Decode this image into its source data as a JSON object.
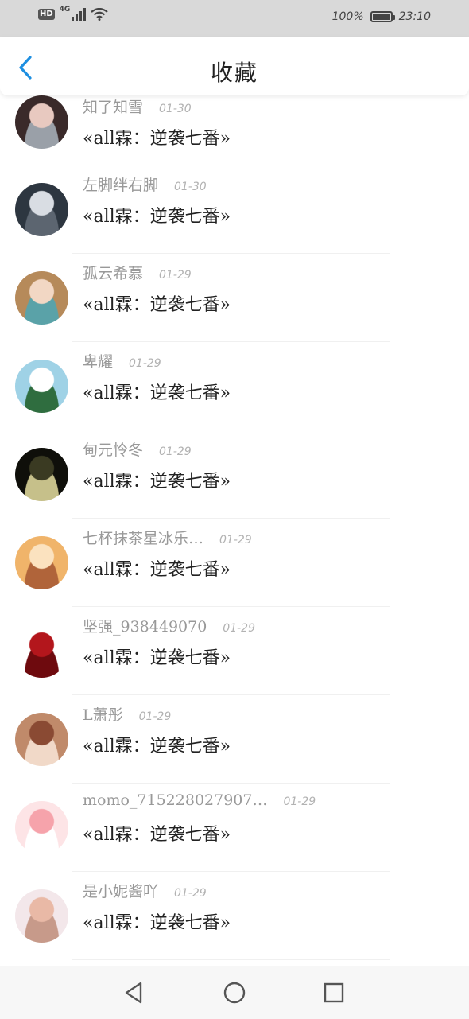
{
  "status_bar": {
    "hd_label": "HD",
    "network_label": "4G",
    "battery_percent": "100%",
    "time": "23:10"
  },
  "header": {
    "title": "收藏"
  },
  "favorites": [
    {
      "username": "知了知雪",
      "date": "01-30",
      "message": "«all霖：逆袭七番»",
      "avatar_colors": [
        "#3a2a2a",
        "#e8c9c0",
        "#9aa0a8"
      ]
    },
    {
      "username": "左脚绊右脚",
      "date": "01-30",
      "message": "«all霖：逆袭七番»",
      "avatar_colors": [
        "#2d3640",
        "#d9dde3",
        "#5c6570"
      ]
    },
    {
      "username": "孤云希慕",
      "date": "01-29",
      "message": "«all霖：逆袭七番»",
      "avatar_colors": [
        "#b68a5a",
        "#f2d7c4",
        "#5aa2a8"
      ]
    },
    {
      "username": "卑耀",
      "date": "01-29",
      "message": "«all霖：逆袭七番»",
      "avatar_colors": [
        "#9fd2e6",
        "#ffffff",
        "#2f6d3f"
      ]
    },
    {
      "username": "甸元怜冬",
      "date": "01-29",
      "message": "«all霖：逆袭七番»",
      "avatar_colors": [
        "#0f0f0a",
        "#3a3a22",
        "#c6c08a"
      ]
    },
    {
      "username": "七杯抹茶星冰乐…",
      "date": "01-29",
      "message": "«all霖：逆袭七番»",
      "avatar_colors": [
        "#f0b46a",
        "#fbe2bf",
        "#b0643a"
      ]
    },
    {
      "username": "坚强_938449070",
      "date": "01-29",
      "message": "«all霖：逆袭七番»",
      "avatar_colors": [
        "#ffffff",
        "#b3161c",
        "#6e0a0e"
      ]
    },
    {
      "username": "L萧彤",
      "date": "01-29",
      "message": "«all霖：逆袭七番»",
      "avatar_colors": [
        "#c08a6a",
        "#8a4a33",
        "#f1d9c8"
      ]
    },
    {
      "username": "momo_715228027907…",
      "date": "01-29",
      "message": "«all霖：逆袭七番»",
      "avatar_colors": [
        "#fde4e6",
        "#f6a3ab",
        "#ffffff"
      ]
    },
    {
      "username": "是小妮酱吖",
      "date": "01-29",
      "message": "«all霖：逆袭七番»",
      "avatar_colors": [
        "#f3e7ea",
        "#e9b9a6",
        "#c79a8a"
      ]
    }
  ],
  "nav": {
    "back_icon": "triangle-back-icon",
    "home_icon": "circle-home-icon",
    "recents_icon": "square-recents-icon"
  },
  "colors": {
    "accent": "#1e8fe1",
    "status_bar_bg": "#d9d9d9"
  }
}
